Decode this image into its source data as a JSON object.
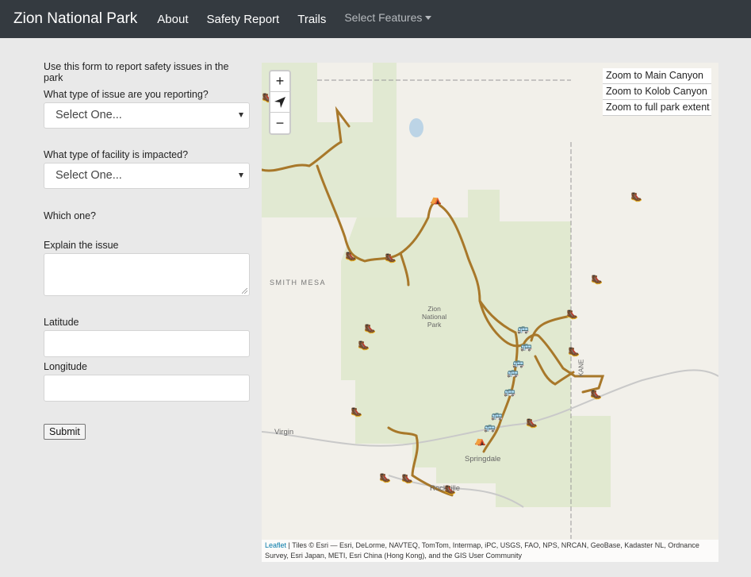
{
  "navbar": {
    "brand": "Zion National Park",
    "links": [
      "About",
      "Safety Report",
      "Trails"
    ],
    "dropdown_label": "Select Features"
  },
  "form": {
    "intro": "Use this form to report safety issues in the park",
    "issue_type_label": "What type of issue are you reporting?",
    "issue_type_value": "Select One...",
    "facility_type_label": "What type of facility is impacted?",
    "facility_type_value": "Select One...",
    "which_one_label": "Which one?",
    "explain_label": "Explain the issue",
    "latitude_label": "Latitude",
    "longitude_label": "Longitude",
    "submit_label": "Submit"
  },
  "map": {
    "zoom_in": "+",
    "zoom_out": "−",
    "zoom_links": [
      "Zoom to Main Canyon",
      "Zoom to Kolob Canyon",
      "Zoom to full park extent"
    ],
    "place_labels": {
      "smith_mesa": "SMITH MESA",
      "park_line1": "Zion",
      "park_line2": "National",
      "park_line3": "Park",
      "virgin": "Virgin",
      "springdale": "Springdale",
      "rockville": "Rockville",
      "kane": "KANE"
    },
    "attribution_link": "Leaflet",
    "attribution_text": " | Tiles © Esri — Esri, DeLorme, NAVTEQ, TomTom, Intermap, iPC, USGS, FAO, NPS, NRCAN, GeoBase, Kadaster NL, Ordnance Survey, Esri Japan, METI, Esri China (Hong Kong), and the GIS User Community",
    "colors": {
      "trail": "#a8782a",
      "park_fill": "#dfe8cf",
      "background": "#f2f0ea"
    },
    "icons": {
      "hiker": "🥾",
      "bus": "🚌",
      "campground": "⛺"
    }
  }
}
